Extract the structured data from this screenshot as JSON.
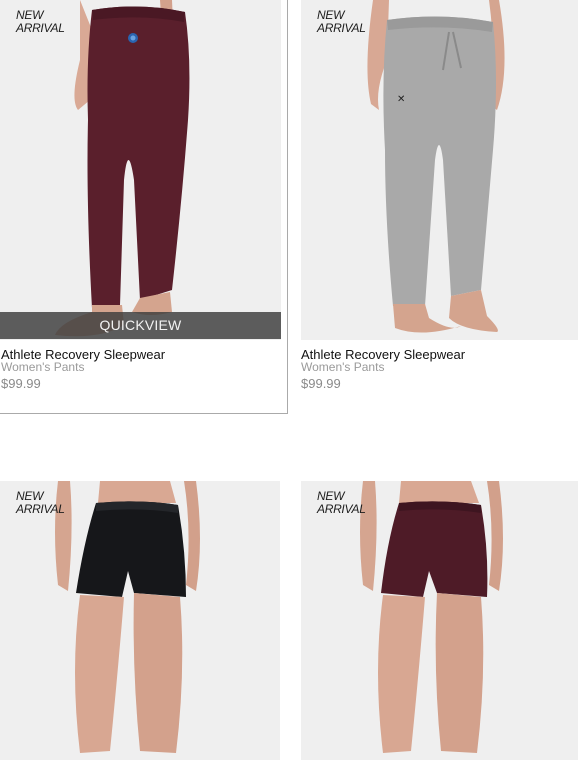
{
  "products": [
    {
      "badge_line1": "NEW",
      "badge_line2": "ARRIVAL",
      "name": "Athlete Recovery Sleepwear",
      "category": "Women's Pants",
      "price": "$99.99",
      "quickview_label": "QUICKVIEW",
      "garment_color": "#5a1f2c",
      "garment": "pants"
    },
    {
      "badge_line1": "NEW",
      "badge_line2": "ARRIVAL",
      "name": "Athlete Recovery Sleepwear",
      "category": "Women's Pants",
      "price": "$99.99",
      "garment_color": "#a9a9a9",
      "garment": "joggers"
    },
    {
      "badge_line1": "NEW",
      "badge_line2": "ARRIVAL",
      "garment_color": "#16171a",
      "garment": "shorts"
    },
    {
      "badge_line1": "NEW",
      "badge_line2": "ARRIVAL",
      "garment_color": "#4e1b27",
      "garment": "shorts"
    }
  ]
}
